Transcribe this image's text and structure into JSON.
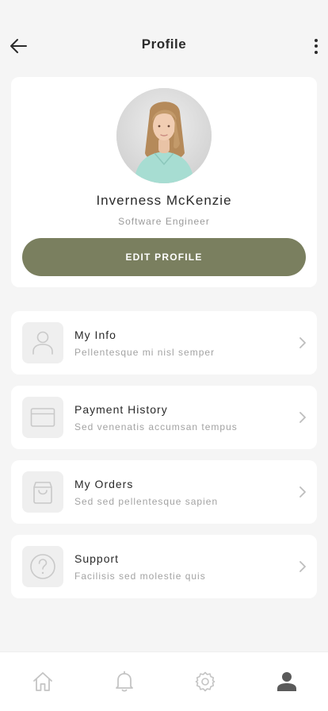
{
  "header": {
    "title": "Profile",
    "back_icon": "arrow-left-icon",
    "more_icon": "more-vertical-icon"
  },
  "profile": {
    "name": "Inverness McKenzie",
    "role": "Software Engineer",
    "edit_button_label": "EDIT PROFILE",
    "avatar": "profile-photo"
  },
  "menu": {
    "items": [
      {
        "title": "My Info",
        "subtitle": "Pellentesque mi nisl semper",
        "icon": "user-icon"
      },
      {
        "title": "Payment History",
        "subtitle": "Sed venenatis accumsan tempus",
        "icon": "credit-card-icon"
      },
      {
        "title": "My Orders",
        "subtitle": "Sed sed pellentesque sapien",
        "icon": "shopping-bag-icon"
      },
      {
        "title": "Support",
        "subtitle": "Facilisis sed molestie quis",
        "icon": "help-circle-icon"
      }
    ]
  },
  "bottom_nav": {
    "items": [
      {
        "icon": "home-icon",
        "active": false
      },
      {
        "icon": "bell-icon",
        "active": false
      },
      {
        "icon": "settings-icon",
        "active": false
      },
      {
        "icon": "user-icon",
        "active": true
      }
    ]
  },
  "colors": {
    "accent": "#7a7f5f",
    "nav_active": "#5a5a5a",
    "nav_inactive": "#c4c4c4",
    "background": "#f5f5f5"
  }
}
